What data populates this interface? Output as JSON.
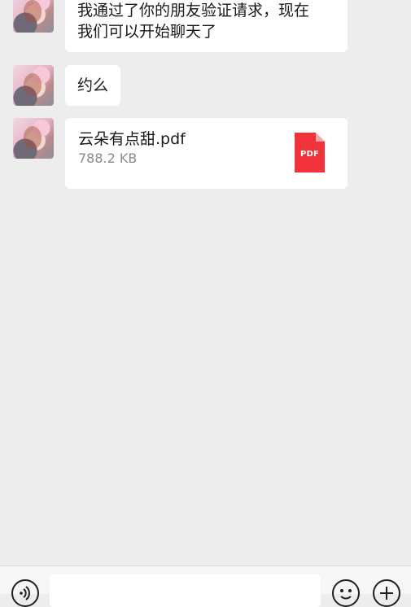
{
  "messages": [
    {
      "type": "text",
      "text": "我通过了你的朋友验证请求，现在\n我们可以开始聊天了"
    },
    {
      "type": "text",
      "text": "约么"
    },
    {
      "type": "file",
      "file_name": "云朵有点甜.pdf",
      "file_size": "788.2 KB",
      "file_type_label": "PDF",
      "icon": "pdf-file-icon"
    }
  ],
  "input_bar": {
    "voice_icon": "voice-icon",
    "emoji_icon": "emoji-icon",
    "plus_icon": "plus-icon",
    "message_value": ""
  },
  "colors": {
    "background": "#ededed",
    "bubble": "#ffffff",
    "pdf_red": "#f2323a"
  }
}
